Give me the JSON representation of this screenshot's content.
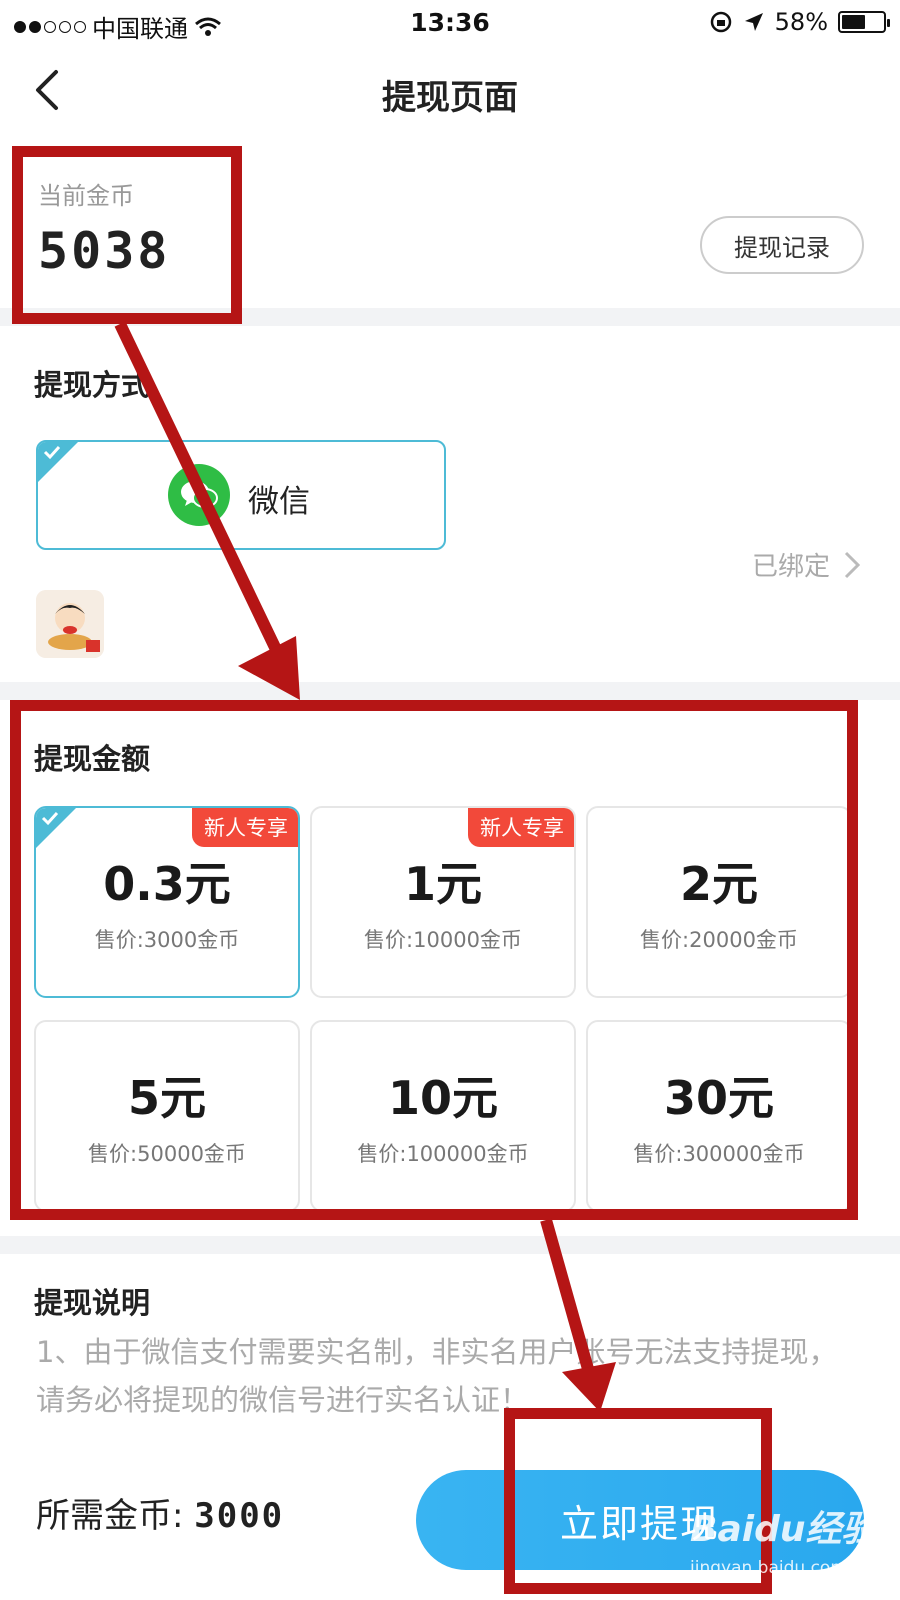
{
  "status_bar": {
    "carrier": "中国联通",
    "time": "13:36",
    "battery": "58%",
    "battery_level": 0.58
  },
  "nav": {
    "title": "提现页面"
  },
  "coins": {
    "label": "当前金币",
    "value": "5038",
    "record_button": "提现记录"
  },
  "method": {
    "title": "提现方式",
    "selected_option": "微信",
    "bound_label": "已绑定"
  },
  "amount": {
    "title": "提现金额",
    "options": [
      {
        "value": "0.3元",
        "price": "售价:3000金币",
        "badge": "新人专享",
        "selected": true
      },
      {
        "value": "1元",
        "price": "售价:10000金币",
        "badge": "新人专享",
        "selected": false
      },
      {
        "value": "2元",
        "price": "售价:20000金币",
        "badge": "",
        "selected": false
      },
      {
        "value": "5元",
        "price": "售价:50000金币",
        "badge": "",
        "selected": false
      },
      {
        "value": "10元",
        "price": "售价:100000金币",
        "badge": "",
        "selected": false
      },
      {
        "value": "30元",
        "price": "售价:300000金币",
        "badge": "",
        "selected": false
      }
    ]
  },
  "description": {
    "title": "提现说明",
    "text": "1、由于微信支付需要实名制，非实名用户账号无法支持提现，请务必将提现的微信号进行实名认证！"
  },
  "bottom": {
    "need_label": "所需金币: ",
    "need_value": "3000",
    "withdraw_button": "立即提现"
  },
  "watermark": {
    "main": "Baidu经验",
    "sub": "jingyan.baidu.com"
  },
  "colors": {
    "accent": "#4dbbd6",
    "button": "#2aa8ee",
    "badge": "#f2493a",
    "annotation": "#b51515",
    "wechat": "#2fbd45"
  }
}
